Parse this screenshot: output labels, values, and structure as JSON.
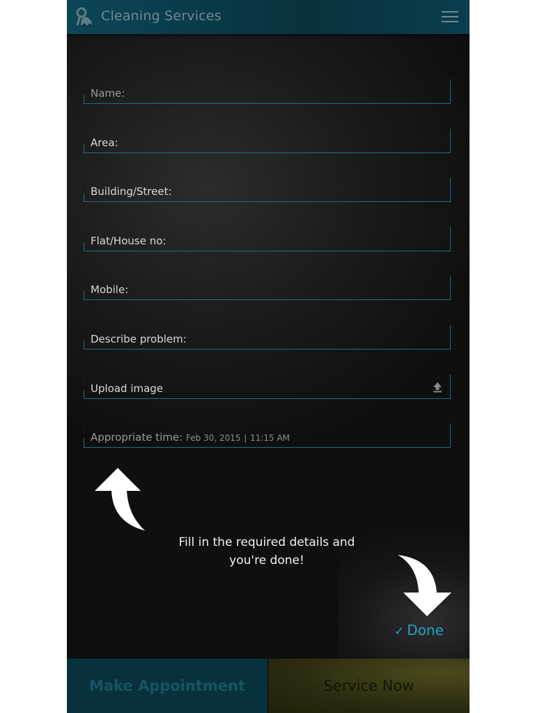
{
  "header": {
    "title": "Cleaning Services",
    "app_icon": "vacuum-icon",
    "menu_icon": "hamburger-menu-icon"
  },
  "form": {
    "fields": [
      {
        "label": "Name:"
      },
      {
        "label": "Area:"
      },
      {
        "label": "Building/Street:"
      },
      {
        "label": "Flat/House no:"
      },
      {
        "label": "Mobile:"
      },
      {
        "label": "Describe problem:"
      },
      {
        "label": "Upload image",
        "icon": "upload-icon"
      },
      {
        "label": "Appropriate time:",
        "date": "Feb 30, 2015",
        "separator": "|",
        "time": "11:15 AM"
      }
    ]
  },
  "overlay": {
    "hint_line1": "Fill in the required details and",
    "hint_line2": "you're done!",
    "done_check": "✓",
    "done_label": "Done"
  },
  "bottom_bar": {
    "left_label": "Make Appointment",
    "right_label": "Service Now"
  },
  "colors": {
    "accent": "#1fa3c4",
    "header_bg": "#07313d",
    "field_border": "#1e6f82",
    "service_now_bg": "#2c2b10"
  }
}
